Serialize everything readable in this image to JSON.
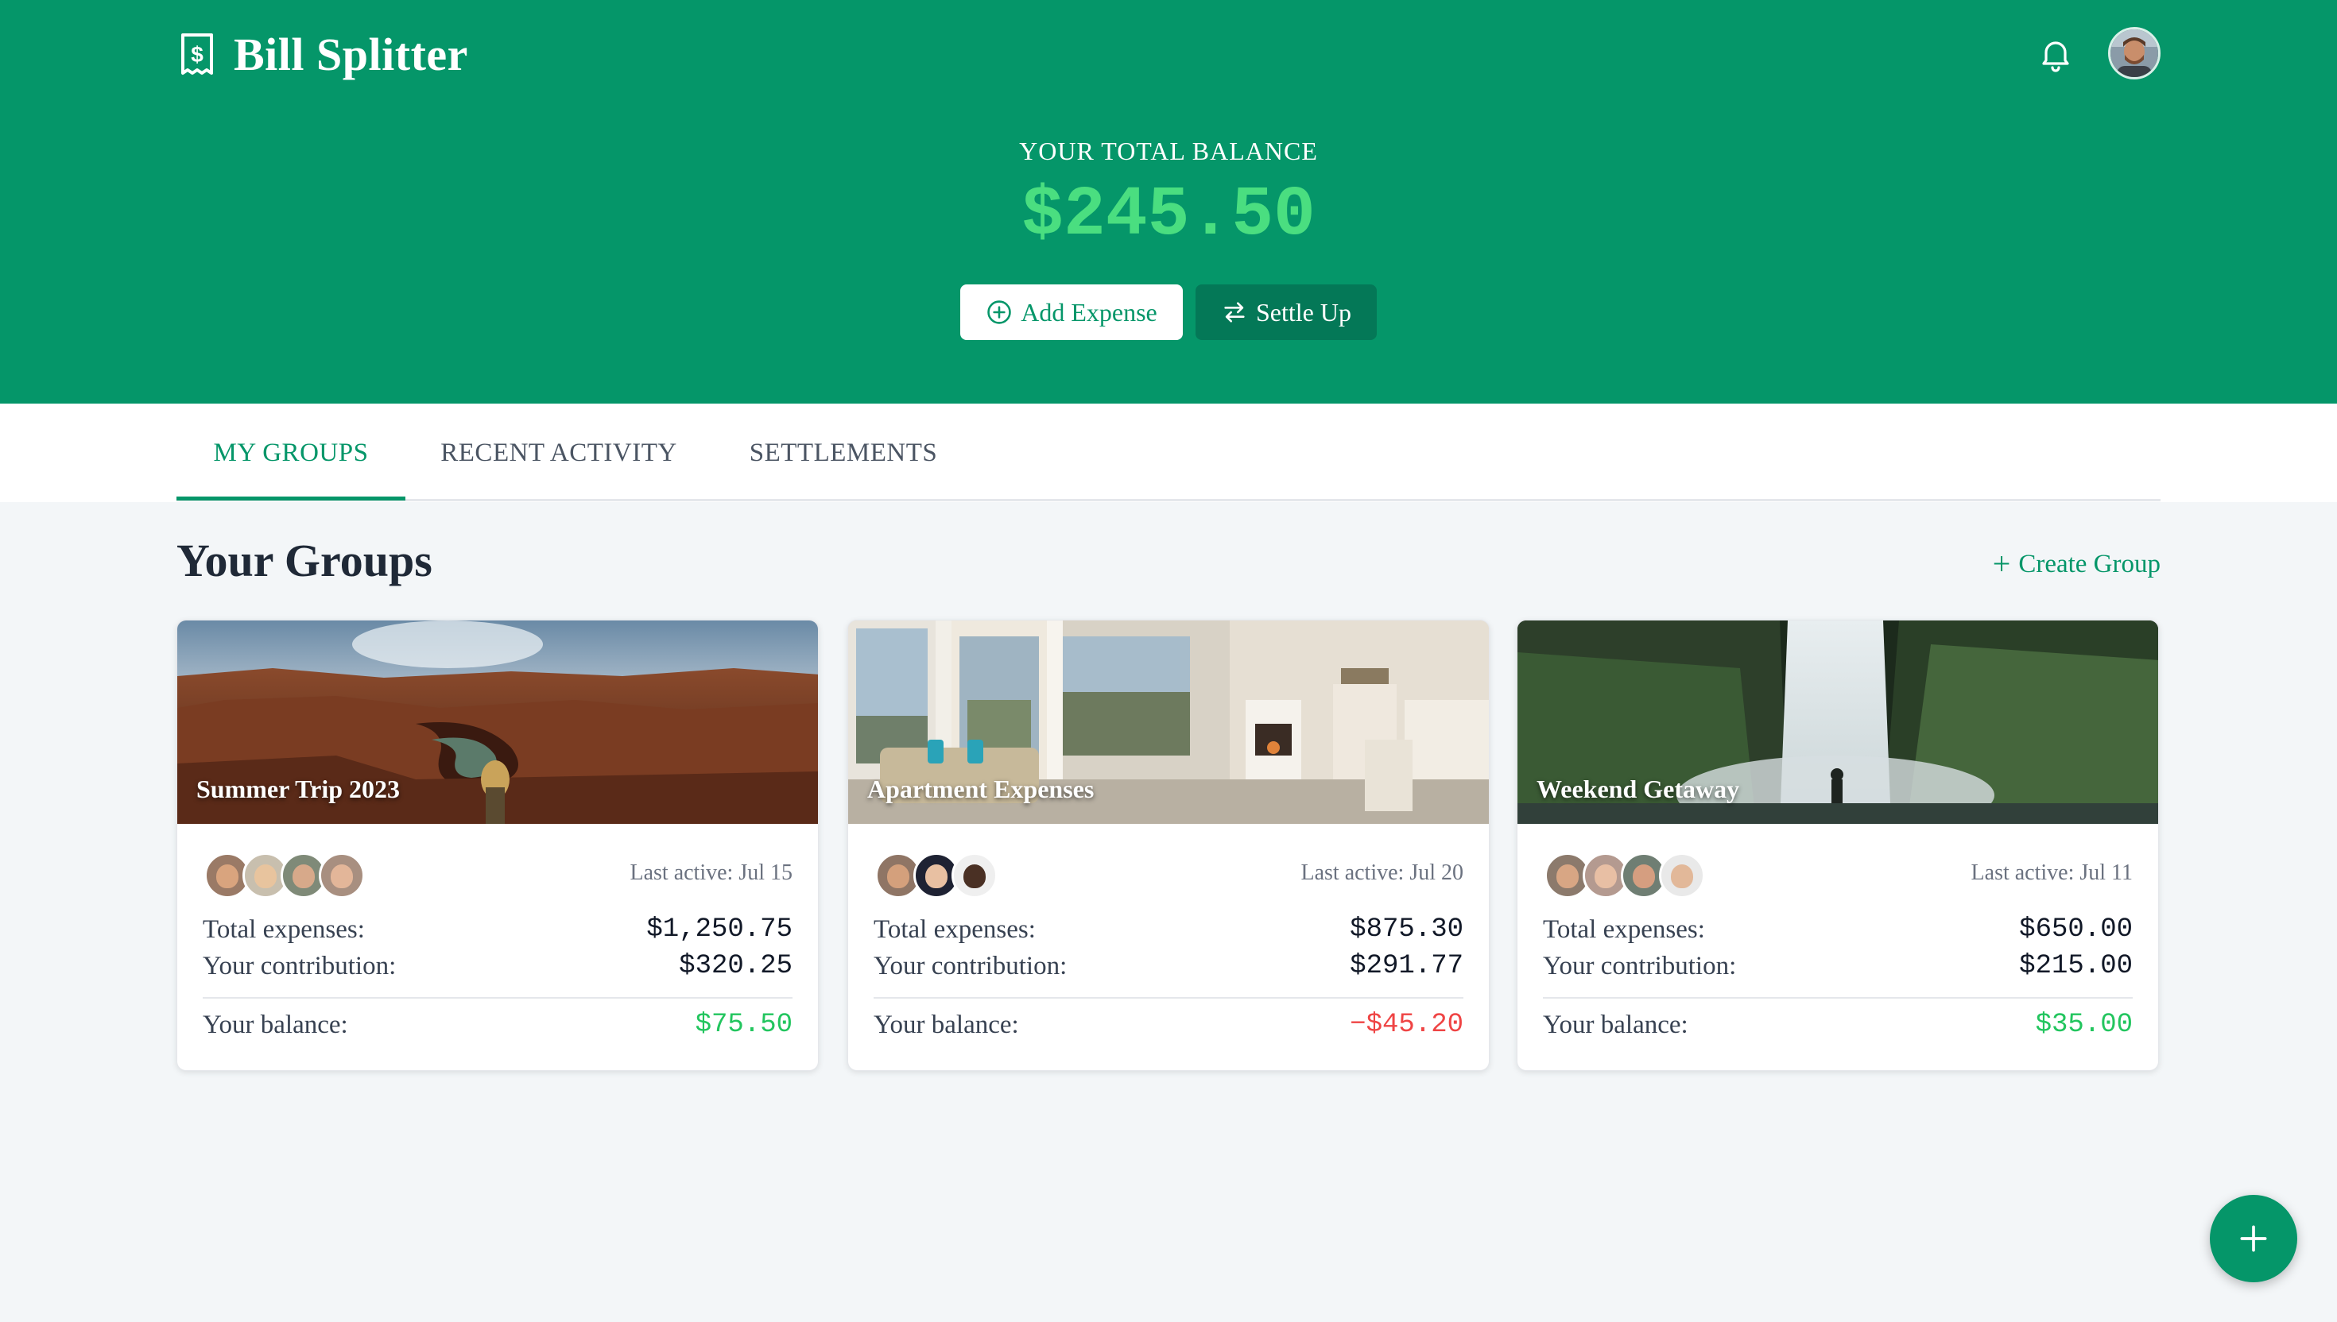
{
  "app": {
    "title": "Bill Splitter",
    "brand_icon": "receipt-dollar-icon",
    "notification_icon": "bell-icon"
  },
  "hero": {
    "balance_label": "YOUR TOTAL BALANCE",
    "balance_amount": "$245.50",
    "add_expense_label": "Add Expense",
    "settle_up_label": "Settle Up"
  },
  "tabs": [
    {
      "label": "MY GROUPS",
      "active": true
    },
    {
      "label": "RECENT ACTIVITY",
      "active": false
    },
    {
      "label": "SETTLEMENTS",
      "active": false
    }
  ],
  "groups_section": {
    "title": "Your Groups",
    "create_label": "Create Group"
  },
  "groups": [
    {
      "name": "Summer Trip 2023",
      "last_active": "Last active: Jul 15",
      "total_label": "Total expenses:",
      "total": "$1,250.75",
      "contribution_label": "Your contribution:",
      "contribution": "$320.25",
      "balance_label": "Your balance:",
      "balance": "$75.50",
      "balance_status": "positive",
      "member_count": 4
    },
    {
      "name": "Apartment Expenses",
      "last_active": "Last active: Jul 20",
      "total_label": "Total expenses:",
      "total": "$875.30",
      "contribution_label": "Your contribution:",
      "contribution": "$291.77",
      "balance_label": "Your balance:",
      "balance": "−$45.20",
      "balance_status": "negative",
      "member_count": 3
    },
    {
      "name": "Weekend Getaway",
      "last_active": "Last active: Jul 11",
      "total_label": "Total expenses:",
      "total": "$650.00",
      "contribution_label": "Your contribution:",
      "contribution": "$215.00",
      "balance_label": "Your balance:",
      "balance": "$35.00",
      "balance_status": "positive",
      "member_count": 4
    }
  ],
  "colors": {
    "primary": "#059669",
    "primary_dark": "#047857",
    "positive": "#22c55e",
    "negative": "#ef4444"
  }
}
